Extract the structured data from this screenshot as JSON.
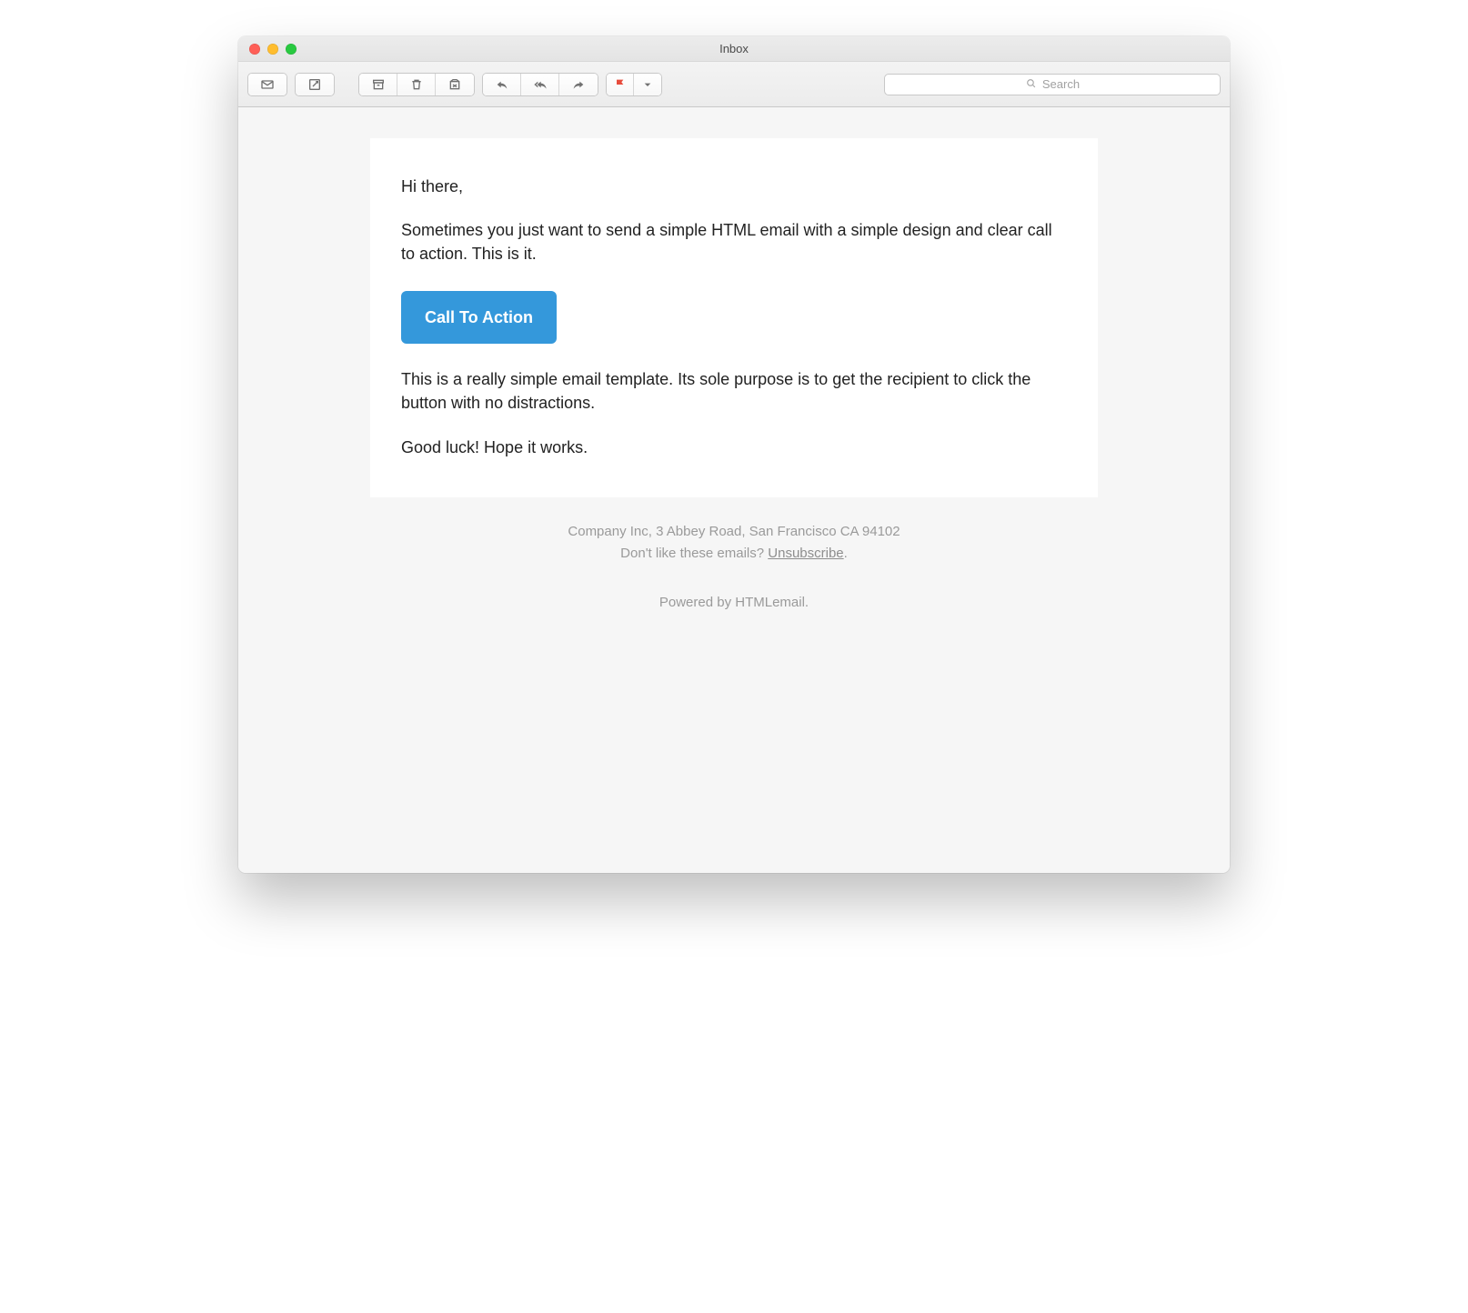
{
  "window": {
    "title": "Inbox"
  },
  "toolbar": {
    "icons": {
      "inbox": "inbox",
      "compose": "compose",
      "archive": "archive",
      "trash": "trash",
      "junk": "junk",
      "reply": "reply",
      "reply_all": "reply-all",
      "forward": "forward",
      "flag": "flag",
      "flag_menu": "▾"
    },
    "search_placeholder": "Search"
  },
  "email": {
    "greeting": "Hi there,",
    "intro": "Sometimes you just want to send a simple HTML email with a simple design and clear call to action. This is it.",
    "cta_label": "Call To Action",
    "body": "This is a really simple email template. Its sole purpose is to get the recipient to click the button with no distractions.",
    "signoff": "Good luck! Hope it works."
  },
  "footer": {
    "address": "Company Inc, 3 Abbey Road, San Francisco CA 94102",
    "unsub_prefix": "Don't like these emails? ",
    "unsub_link": "Unsubscribe",
    "unsub_suffix": ".",
    "powered": "Powered by HTMLemail."
  },
  "colors": {
    "cta": "#3498db",
    "footer_text": "#9a9a9a"
  }
}
